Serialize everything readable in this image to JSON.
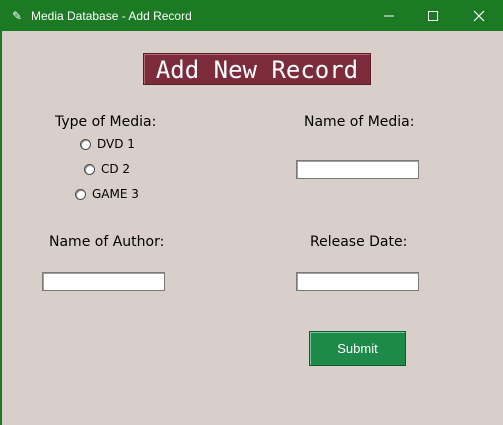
{
  "window": {
    "title": "Media Database - Add Record",
    "icon": "feather-icon",
    "controls": [
      "minimize-icon",
      "maximize-icon",
      "close-icon"
    ]
  },
  "form": {
    "heading": "Add New Record",
    "type_label": "Type of Media:",
    "media_types": [
      "DVD 1",
      "CD 2",
      "GAME 3"
    ],
    "name_label": "Name of Media:",
    "author_label": "Name of Author:",
    "release_label": "Release Date:",
    "name_value": "",
    "author_value": "",
    "release_value": "",
    "submit_label": "Submit"
  },
  "colors": {
    "titlebar": "#1c7a25",
    "background": "#d9cfca",
    "heading_bg": "#7c2b3a",
    "submit_bg": "#1e8a4a"
  }
}
